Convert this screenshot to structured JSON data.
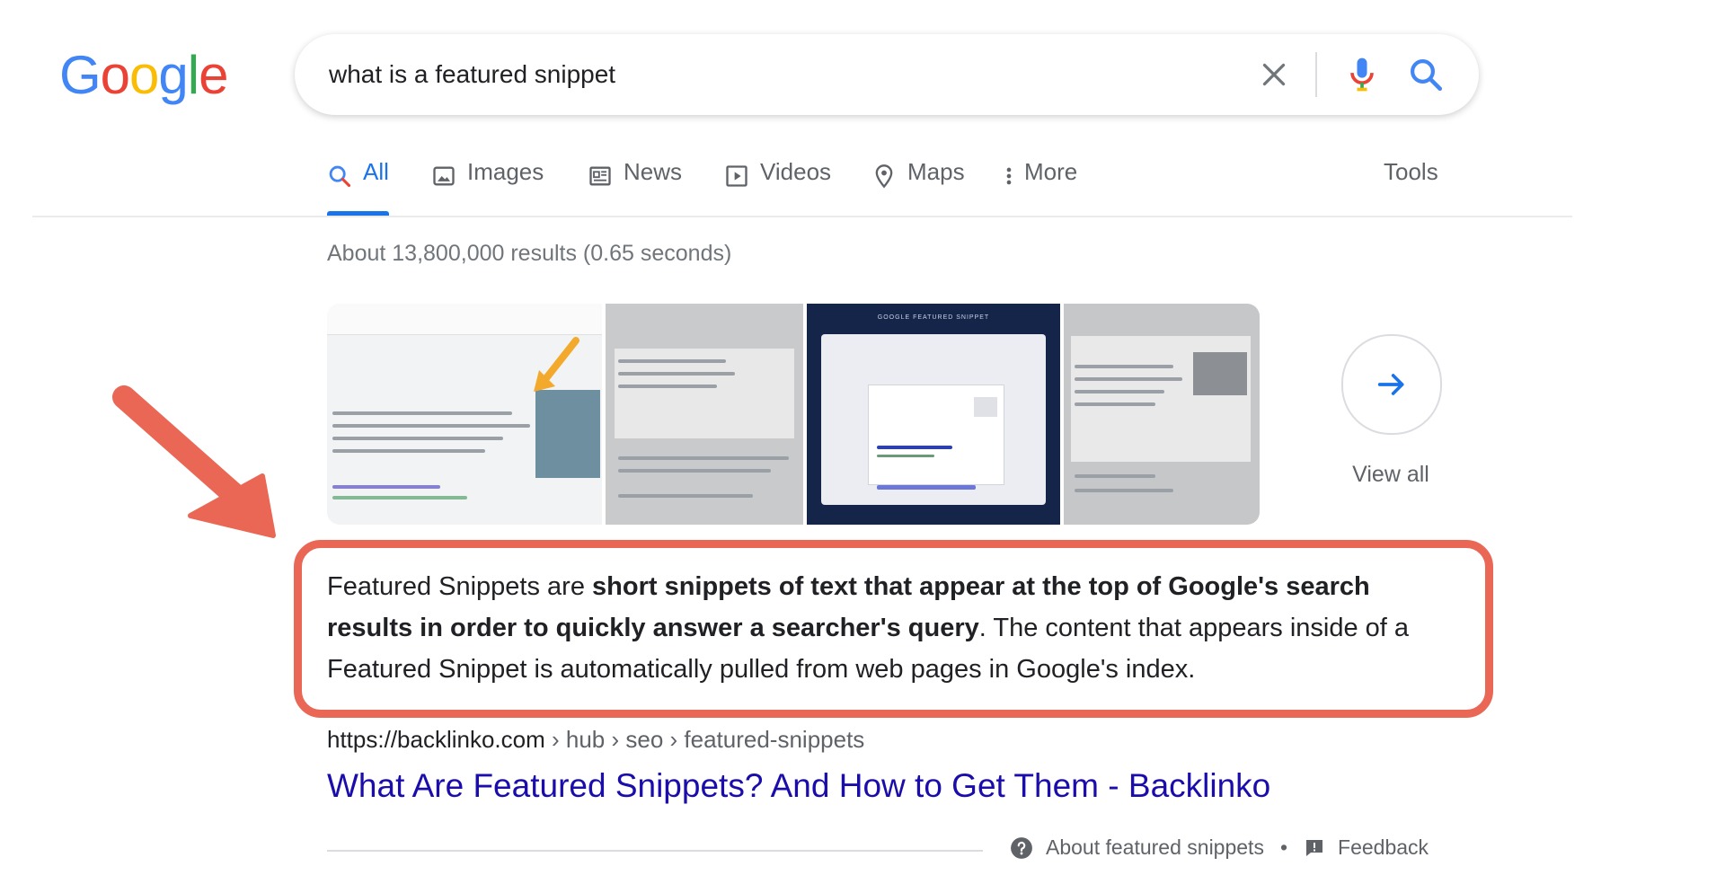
{
  "logo": {
    "text": "Google",
    "letters": [
      "G",
      "o",
      "o",
      "g",
      "l",
      "e"
    ],
    "colors": [
      "#4285f4",
      "#ea4335",
      "#fbbc05",
      "#4285f4",
      "#34a853",
      "#ea4335"
    ]
  },
  "search": {
    "query": "what is a featured snippet",
    "icons": [
      "close-icon",
      "mic-icon",
      "search-icon"
    ]
  },
  "tabs": [
    {
      "label": "All",
      "icon": "search-icon",
      "active": true
    },
    {
      "label": "Images",
      "icon": "image-icon"
    },
    {
      "label": "News",
      "icon": "news-icon"
    },
    {
      "label": "Videos",
      "icon": "play-icon"
    },
    {
      "label": "Maps",
      "icon": "map-pin-icon"
    },
    {
      "label": "More",
      "icon": "more-vert-icon"
    }
  ],
  "tools_label": "Tools",
  "stats": "About 13,800,000 results (0.65 seconds)",
  "images": {
    "view_all": "View all",
    "thumb_text": "GOOGLE FEATURED SNIPPET"
  },
  "snippet": {
    "pre": "Featured Snippets are ",
    "bold": "short snippets of text that appear at the top of Google's search results in order to quickly answer a searcher's query",
    "post": ". The content that appears inside of a Featured Snippet is automatically pulled from web pages in Google's index."
  },
  "result": {
    "url": "https://backlinko.com",
    "path": " › hub › seo › featured-snippets",
    "title": "What Are Featured Snippets? And How to Get Them - Backlinko"
  },
  "footer": {
    "about": "About featured snippets",
    "separator": "•",
    "feedback": "Feedback"
  },
  "colors": {
    "accent": "#1a73e8",
    "link": "#1a0dab",
    "highlight": "#ea6756"
  }
}
